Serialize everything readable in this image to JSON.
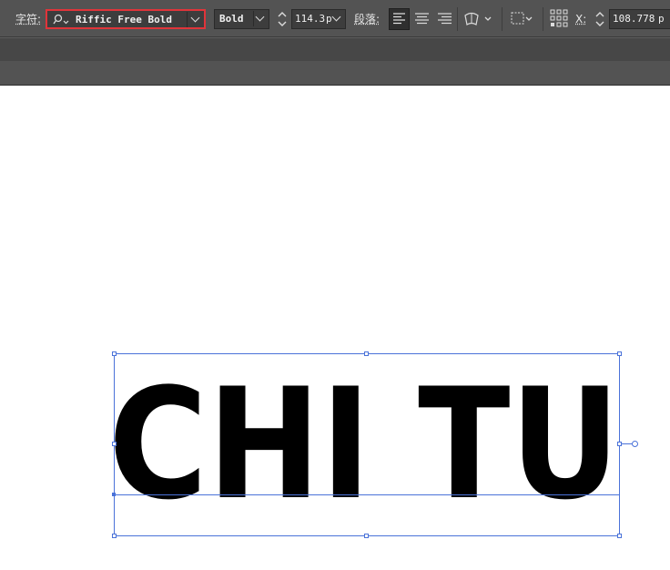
{
  "toolbar": {
    "character_label": "字符:",
    "font_family": "Riffic Free Bold",
    "font_style": "Bold",
    "font_size": "114.3",
    "font_size_unit": "p",
    "paragraph_label": "段落:",
    "x_label": "X:",
    "x_value": "108.778",
    "x_unit": "p"
  },
  "canvas": {
    "text": "CHI TU"
  },
  "icons": {
    "font_search": "magnifier-dropdown-icon",
    "align_left": "align-left-icon",
    "align_center": "align-center-icon",
    "align_right": "align-right-icon",
    "warp": "text-warp-icon",
    "transform": "transform-box-icon",
    "reference_point": "reference-point-icon"
  },
  "colors": {
    "highlight": "#e0343a",
    "selection": "#4a72d9",
    "toolbar_bg": "#535353"
  }
}
